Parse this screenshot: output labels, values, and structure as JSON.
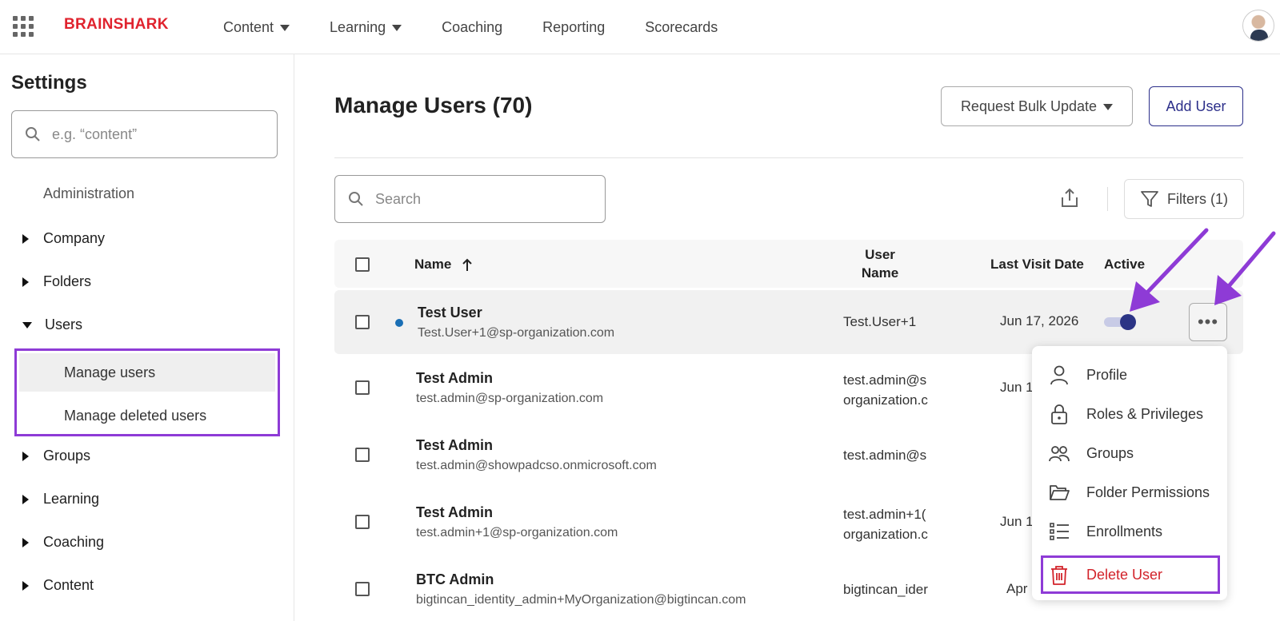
{
  "header": {
    "logo": "BRAINSHARK",
    "nav": [
      {
        "label": "Content",
        "dropdown": true
      },
      {
        "label": "Learning",
        "dropdown": true
      },
      {
        "label": "Coaching",
        "dropdown": false
      },
      {
        "label": "Reporting",
        "dropdown": false
      },
      {
        "label": "Scorecards",
        "dropdown": false
      }
    ]
  },
  "sidebar": {
    "title": "Settings",
    "search_placeholder": "e.g. “content”",
    "section": "Administration",
    "items": [
      {
        "label": "Company",
        "expanded": false
      },
      {
        "label": "Folders",
        "expanded": false
      },
      {
        "label": "Users",
        "expanded": true
      },
      {
        "label": "Groups",
        "expanded": false
      },
      {
        "label": "Learning",
        "expanded": false
      },
      {
        "label": "Coaching",
        "expanded": false
      },
      {
        "label": "Content",
        "expanded": false
      }
    ],
    "users_sub": [
      {
        "label": "Manage users",
        "active": true
      },
      {
        "label": "Manage deleted users",
        "active": false
      }
    ]
  },
  "main": {
    "title": "Manage Users (70)",
    "bulk_button": "Request Bulk Update",
    "add_button": "Add User",
    "search_placeholder": "Search",
    "filters_button": "Filters (1)",
    "table": {
      "columns": [
        "Name",
        "User Name",
        "Last Visit Date",
        "Active"
      ],
      "column_user_line1": "User",
      "column_user_line2": "Name",
      "rows": [
        {
          "name": "Test User",
          "email": "Test.User+1@sp-organization.com",
          "username": "Test.User+1",
          "username2": "",
          "date": "Jun 17, 2026",
          "active": true
        },
        {
          "name": "Test Admin",
          "email": "test.admin@sp-organization.com",
          "username": "test.admin@s",
          "username2": "organization.c",
          "date": "Jun 1"
        },
        {
          "name": "Test Admin",
          "email": "test.admin@showpadcso.onmicrosoft.com",
          "username": "test.admin@s",
          "username2": "",
          "date": ""
        },
        {
          "name": "Test Admin",
          "email": "test.admin+1@sp-organization.com",
          "username": "test.admin+1(",
          "username2": "organization.c",
          "date": "Jun 1"
        },
        {
          "name": "BTC Admin",
          "email": "bigtincan_identity_admin+MyOrganization@bigtincan.com",
          "username": "bigtincan_ider",
          "username2": "",
          "date": "Apr"
        }
      ]
    },
    "row_menu": {
      "items": [
        "Profile",
        "Roles & Privileges",
        "Groups",
        "Folder Permissions",
        "Enrollments",
        "Delete User"
      ]
    }
  },
  "colors": {
    "brand": "#e0232e",
    "accent": "#2c2f8a",
    "highlight": "#8e3bd6",
    "danger": "#d2232a"
  }
}
